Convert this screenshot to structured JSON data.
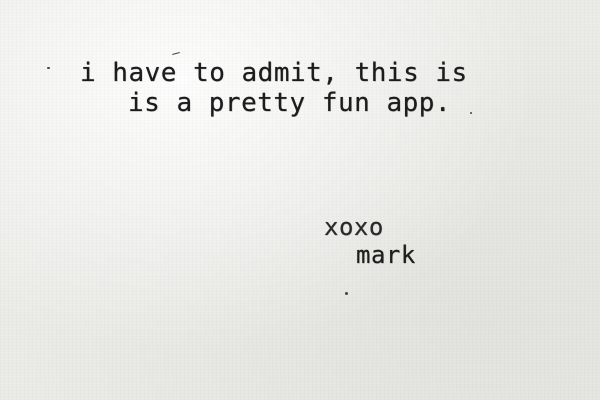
{
  "note": {
    "line1": "i have to admit, this is",
    "line2": "is a pretty fun app.",
    "sign_line1": "xoxo",
    "sign_line2": "mark"
  },
  "colors": {
    "paper": "#ebebe8",
    "ink": "#1c1c1c"
  }
}
